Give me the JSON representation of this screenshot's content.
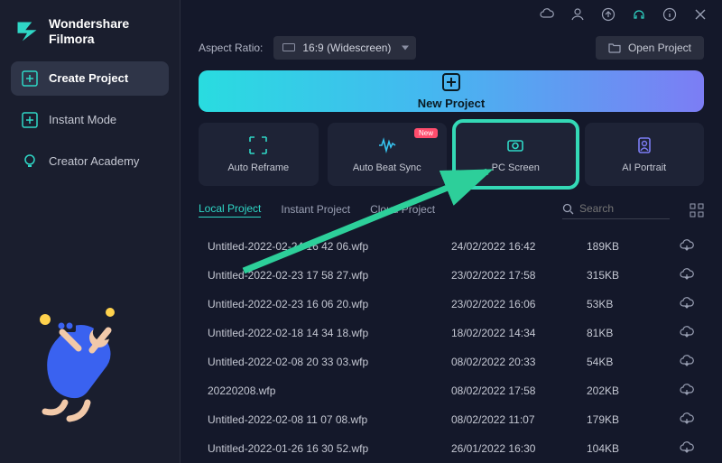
{
  "app": {
    "brand1": "Wondershare",
    "brand2": "Filmora"
  },
  "sidebar": {
    "items": [
      {
        "label": "Create Project"
      },
      {
        "label": "Instant Mode"
      },
      {
        "label": "Creator Academy"
      }
    ]
  },
  "toolbar": {
    "aspect_label": "Aspect Ratio:",
    "aspect_value": "16:9 (Widescreen)",
    "open_project": "Open Project"
  },
  "hero": {
    "label": "New Project"
  },
  "actions": [
    {
      "label": "Auto Reframe",
      "badge": ""
    },
    {
      "label": "Auto Beat Sync",
      "badge": "New"
    },
    {
      "label": "PC Screen",
      "badge": ""
    },
    {
      "label": "AI Portrait",
      "badge": ""
    }
  ],
  "tabs": [
    {
      "label": "Local Project"
    },
    {
      "label": "Instant Project"
    },
    {
      "label": "Cloud Project"
    }
  ],
  "search": {
    "placeholder": "Search"
  },
  "projects": [
    {
      "name": "Untitled-2022-02-24 16 42 06.wfp",
      "date": "24/02/2022 16:42",
      "size": "189KB"
    },
    {
      "name": "Untitled-2022-02-23 17 58 27.wfp",
      "date": "23/02/2022 17:58",
      "size": "315KB"
    },
    {
      "name": "Untitled-2022-02-23 16 06 20.wfp",
      "date": "23/02/2022 16:06",
      "size": "53KB"
    },
    {
      "name": "Untitled-2022-02-18 14 34 18.wfp",
      "date": "18/02/2022 14:34",
      "size": "81KB"
    },
    {
      "name": "Untitled-2022-02-08 20 33 03.wfp",
      "date": "08/02/2022 20:33",
      "size": "54KB"
    },
    {
      "name": "20220208.wfp",
      "date": "08/02/2022 17:58",
      "size": "202KB"
    },
    {
      "name": "Untitled-2022-02-08 11 07 08.wfp",
      "date": "08/02/2022 11:07",
      "size": "179KB"
    },
    {
      "name": "Untitled-2022-01-26 16 30 52.wfp",
      "date": "26/01/2022 16:30",
      "size": "104KB"
    }
  ]
}
